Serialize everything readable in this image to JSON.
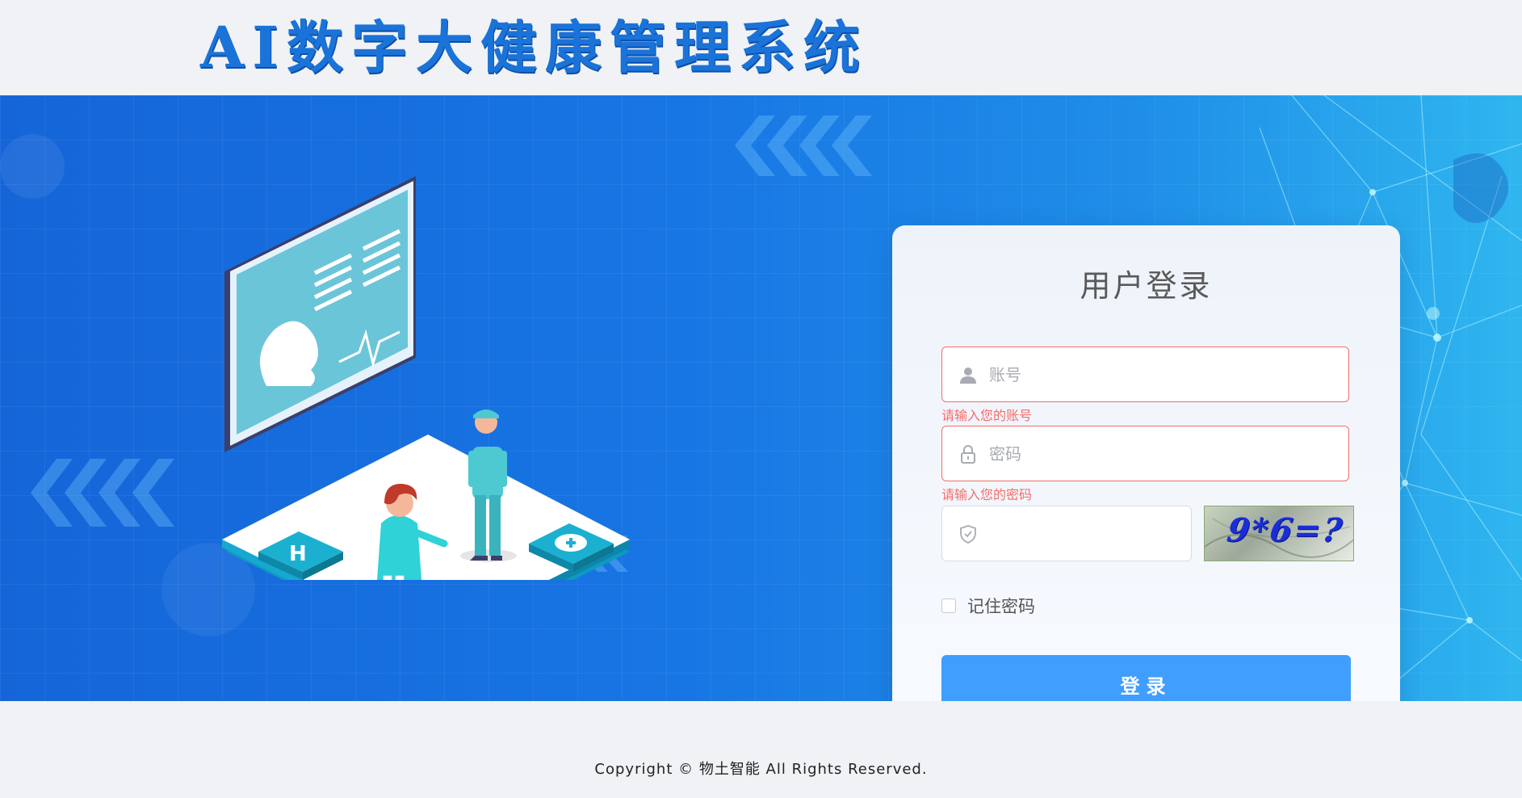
{
  "header": {
    "title": "AI数字大健康管理系统"
  },
  "login": {
    "title": "用户登录",
    "username": {
      "placeholder": "账号",
      "value": "",
      "error": "请输入您的账号",
      "icon": "user-icon"
    },
    "password": {
      "placeholder": "密码",
      "value": "",
      "error": "请输入您的密码",
      "icon": "lock-icon"
    },
    "captcha": {
      "placeholder": "",
      "value": "",
      "icon": "shield-check-icon",
      "image_text": "9*6=?"
    },
    "remember_label": "记住密码",
    "remember_checked": false,
    "submit_label": "登录"
  },
  "footer": {
    "copyright": "Copyright © 物土智能 All Rights Reserved."
  },
  "colors": {
    "primary": "#409eff",
    "error": "#f56c6c",
    "title_blue": "#1a73d8",
    "banner_blue": "#1876e4"
  }
}
